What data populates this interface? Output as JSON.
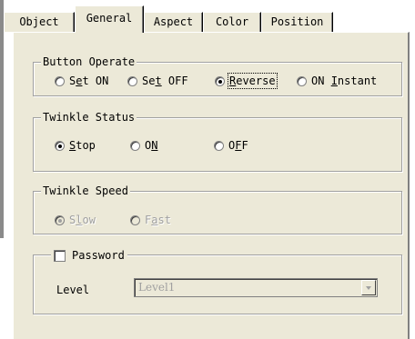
{
  "tabs": [
    "Object",
    "General",
    "Aspect",
    "Color",
    "Position"
  ],
  "active_tab": "General",
  "button_operate": {
    "legend": "Button Operate",
    "options": [
      {
        "pre": "S",
        "key": "e",
        "post": "t ON"
      },
      {
        "pre": "Se",
        "key": "t",
        "post": " OFF"
      },
      {
        "pre": "",
        "key": "R",
        "post": "everse"
      },
      {
        "pre": "ON ",
        "key": "I",
        "post": "nstant"
      }
    ],
    "selected": "Reverse"
  },
  "twinkle_status": {
    "legend": "Twinkle Status",
    "options": [
      {
        "pre": "",
        "key": "S",
        "post": "top"
      },
      {
        "pre": "O",
        "key": "N",
        "post": ""
      },
      {
        "pre": "O",
        "key": "F",
        "post": "F"
      }
    ],
    "selected": "Stop"
  },
  "twinkle_speed": {
    "legend": "Twinkle Speed",
    "options": [
      {
        "pre": "S",
        "key": "l",
        "post": "ow"
      },
      {
        "pre": "F",
        "key": "a",
        "post": "st"
      }
    ],
    "selected": "Slow",
    "enabled": false
  },
  "password": {
    "checkbox_label": "Password",
    "checked": false,
    "level_label": "Level",
    "level_value": "Level1"
  }
}
